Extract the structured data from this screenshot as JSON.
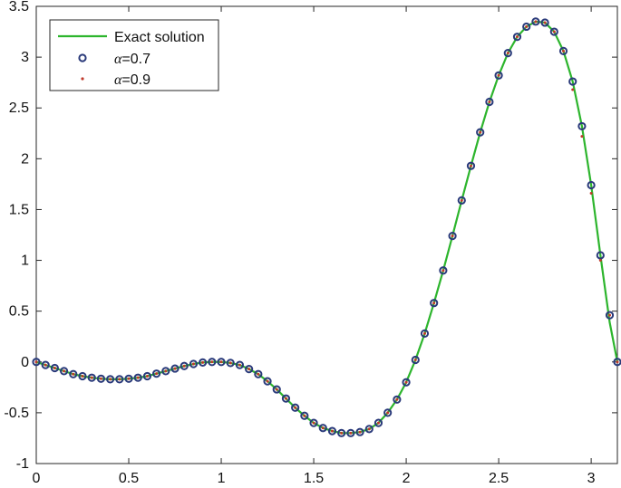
{
  "chart_data": {
    "type": "line",
    "title": "",
    "xlabel": "",
    "ylabel": "",
    "xlim": [
      0,
      3.14159
    ],
    "ylim": [
      -1,
      3.5
    ],
    "xticks": [
      0,
      0.5,
      1,
      1.5,
      2,
      2.5,
      3
    ],
    "xtick_labels": [
      "0",
      "0.5",
      "1",
      "1.5",
      "2",
      "2.5",
      "3"
    ],
    "yticks": [
      -1,
      -0.5,
      0,
      0.5,
      1,
      1.5,
      2,
      2.5,
      3,
      3.5
    ],
    "ytick_labels": [
      "-1",
      "-0.5",
      "0",
      "0.5",
      "1",
      "1.5",
      "2",
      "2.5",
      "3",
      "3.5"
    ],
    "grid": false,
    "legend_position": "top-left",
    "legend": {
      "exact_label": "Exact solution",
      "alpha_symbol": "α",
      "alpha07_value": "=0.7",
      "alpha09_value": "=0.9"
    },
    "series": [
      {
        "name": "Exact solution",
        "style": "line",
        "color": "#2db52d",
        "x": [
          0,
          0.05,
          0.1,
          0.15,
          0.2,
          0.25,
          0.3,
          0.35,
          0.4,
          0.45,
          0.5,
          0.55,
          0.6,
          0.65,
          0.7,
          0.75,
          0.8,
          0.85,
          0.9,
          0.95,
          1.0,
          1.05,
          1.1,
          1.15,
          1.2,
          1.25,
          1.3,
          1.35,
          1.4,
          1.45,
          1.5,
          1.55,
          1.6,
          1.65,
          1.7,
          1.75,
          1.8,
          1.85,
          1.9,
          1.95,
          2.0,
          2.05,
          2.1,
          2.15,
          2.2,
          2.25,
          2.3,
          2.35,
          2.4,
          2.45,
          2.5,
          2.55,
          2.6,
          2.65,
          2.7,
          2.75,
          2.8,
          2.85,
          2.9,
          2.95,
          3.0,
          3.05,
          3.1,
          3.1416
        ],
        "y": [
          0,
          -0.03,
          -0.06,
          -0.09,
          -0.12,
          -0.14,
          -0.155,
          -0.165,
          -0.17,
          -0.17,
          -0.165,
          -0.155,
          -0.14,
          -0.115,
          -0.09,
          -0.065,
          -0.04,
          -0.02,
          -0.005,
          0.0,
          0.0,
          -0.01,
          -0.03,
          -0.07,
          -0.12,
          -0.19,
          -0.27,
          -0.36,
          -0.45,
          -0.53,
          -0.6,
          -0.65,
          -0.68,
          -0.7,
          -0.7,
          -0.69,
          -0.66,
          -0.6,
          -0.5,
          -0.37,
          -0.2,
          0.02,
          0.28,
          0.58,
          0.9,
          1.24,
          1.59,
          1.93,
          2.26,
          2.56,
          2.82,
          3.04,
          3.2,
          3.3,
          3.35,
          3.34,
          3.25,
          3.06,
          2.76,
          2.32,
          1.74,
          1.05,
          0.39,
          0
        ]
      },
      {
        "name": "α=0.7",
        "style": "circle-markers",
        "color": "#2a3a7a",
        "x": [
          0,
          0.05,
          0.1,
          0.15,
          0.2,
          0.25,
          0.3,
          0.35,
          0.4,
          0.45,
          0.5,
          0.55,
          0.6,
          0.65,
          0.7,
          0.75,
          0.8,
          0.85,
          0.9,
          0.95,
          1.0,
          1.05,
          1.1,
          1.15,
          1.2,
          1.25,
          1.3,
          1.35,
          1.4,
          1.45,
          1.5,
          1.55,
          1.6,
          1.65,
          1.7,
          1.75,
          1.8,
          1.85,
          1.9,
          1.95,
          2.0,
          2.05,
          2.1,
          2.15,
          2.2,
          2.25,
          2.3,
          2.35,
          2.4,
          2.45,
          2.5,
          2.55,
          2.6,
          2.65,
          2.7,
          2.75,
          2.8,
          2.85,
          2.9,
          2.95,
          3.0,
          3.05,
          3.1,
          3.1416
        ],
        "y": [
          0,
          -0.03,
          -0.06,
          -0.09,
          -0.12,
          -0.14,
          -0.155,
          -0.165,
          -0.17,
          -0.17,
          -0.165,
          -0.155,
          -0.14,
          -0.115,
          -0.09,
          -0.065,
          -0.04,
          -0.02,
          -0.005,
          0.0,
          0.0,
          -0.01,
          -0.03,
          -0.07,
          -0.12,
          -0.19,
          -0.27,
          -0.36,
          -0.45,
          -0.53,
          -0.6,
          -0.65,
          -0.68,
          -0.7,
          -0.7,
          -0.69,
          -0.66,
          -0.6,
          -0.5,
          -0.37,
          -0.2,
          0.02,
          0.28,
          0.58,
          0.9,
          1.24,
          1.59,
          1.93,
          2.26,
          2.56,
          2.82,
          3.04,
          3.2,
          3.3,
          3.35,
          3.34,
          3.25,
          3.06,
          2.76,
          2.32,
          1.74,
          1.05,
          0.46,
          0
        ]
      },
      {
        "name": "α=0.9",
        "style": "dot-markers",
        "color": "#c0392b",
        "x": [
          0,
          0.05,
          0.1,
          0.15,
          0.2,
          0.25,
          0.3,
          0.35,
          0.4,
          0.45,
          0.5,
          0.55,
          0.6,
          0.65,
          0.7,
          0.75,
          0.8,
          0.85,
          0.9,
          0.95,
          1.0,
          1.05,
          1.1,
          1.15,
          1.2,
          1.25,
          1.3,
          1.35,
          1.4,
          1.45,
          1.5,
          1.55,
          1.6,
          1.65,
          1.7,
          1.75,
          1.8,
          1.85,
          1.9,
          1.95,
          2.0,
          2.05,
          2.1,
          2.15,
          2.2,
          2.25,
          2.3,
          2.35,
          2.4,
          2.45,
          2.5,
          2.55,
          2.6,
          2.65,
          2.7,
          2.75,
          2.8,
          2.85,
          2.9,
          2.95,
          3.0,
          3.05,
          3.1,
          3.1416
        ],
        "y": [
          0,
          -0.03,
          -0.06,
          -0.09,
          -0.12,
          -0.14,
          -0.155,
          -0.165,
          -0.17,
          -0.17,
          -0.165,
          -0.155,
          -0.14,
          -0.115,
          -0.09,
          -0.065,
          -0.04,
          -0.02,
          -0.005,
          0.0,
          0.0,
          -0.01,
          -0.03,
          -0.07,
          -0.12,
          -0.19,
          -0.27,
          -0.36,
          -0.45,
          -0.53,
          -0.6,
          -0.65,
          -0.68,
          -0.7,
          -0.7,
          -0.69,
          -0.66,
          -0.6,
          -0.5,
          -0.37,
          -0.2,
          0.02,
          0.28,
          0.58,
          0.9,
          1.24,
          1.59,
          1.93,
          2.26,
          2.56,
          2.82,
          3.04,
          3.2,
          3.3,
          3.35,
          3.34,
          3.25,
          3.06,
          2.68,
          2.22,
          1.66,
          1.0,
          0.46,
          0
        ]
      }
    ]
  }
}
